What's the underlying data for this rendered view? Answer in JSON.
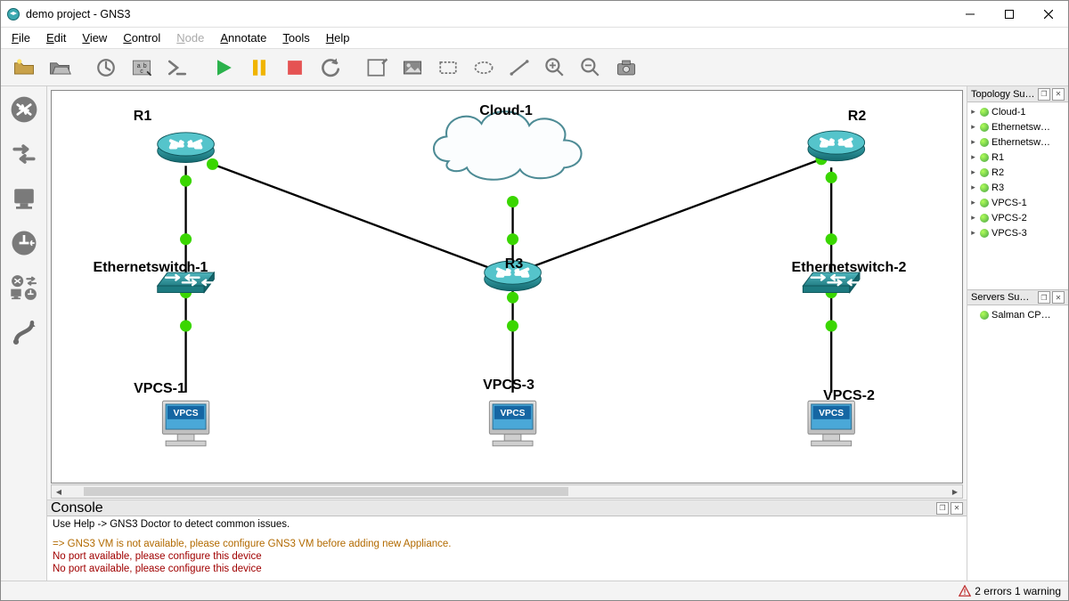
{
  "window": {
    "title": "demo project - GNS3"
  },
  "menu": {
    "file": "File",
    "edit": "Edit",
    "view": "View",
    "control": "Control",
    "node": "Node",
    "annotate": "Annotate",
    "tools": "Tools",
    "help": "Help"
  },
  "topology": {
    "nodes": {
      "r1": "R1",
      "r2": "R2",
      "r3": "R3",
      "cloud1": "Cloud-1",
      "es1": "Ethernetswitch-1",
      "es2": "Ethernetswitch-2",
      "vpcs1": "VPCS-1",
      "vpcs2": "VPCS-2",
      "vpcs3": "VPCS-3",
      "vpcs_badge": "VPCS"
    }
  },
  "panels": {
    "topology_title": "Topology Summ…",
    "servers_title": "Servers Summ…",
    "server0": "Salman CP…",
    "items": {
      "0": "Cloud-1",
      "1": "Ethernetsw…",
      "2": "Ethernetsw…",
      "3": "R1",
      "4": "R2",
      "5": "R3",
      "6": "VPCS-1",
      "7": "VPCS-2",
      "8": "VPCS-3"
    }
  },
  "console": {
    "title": "Console",
    "line_hint": "Use Help -> GNS3 Doctor to detect common issues.",
    "line_vm": "=> GNS3 VM is not available, please configure GNS3 VM before adding new Appliance.",
    "line_port1": "No port available, please configure this device",
    "line_port2": "No port available, please configure this device"
  },
  "status": {
    "text": "2 errors 1 warning"
  }
}
